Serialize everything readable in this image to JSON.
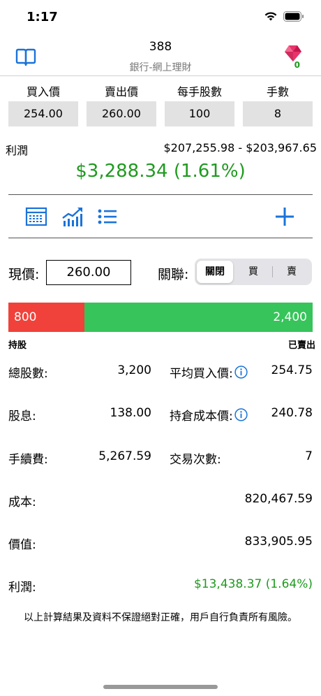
{
  "status": {
    "time": "1:17",
    "wifi_icon": "wifi-icon",
    "battery_icon": "battery-icon"
  },
  "nav": {
    "title": "388",
    "subtitle": "銀行-網上理財",
    "left_icon": "book-icon",
    "right_icon": "gem-icon",
    "gem_count": "0"
  },
  "inputs": [
    {
      "label": "買入價",
      "value": "254.00"
    },
    {
      "label": "賣出價",
      "value": "260.00"
    },
    {
      "label": "每手股數",
      "value": "100"
    },
    {
      "label": "手數",
      "value": "8"
    }
  ],
  "profit": {
    "label": "利潤",
    "range": "$207,255.98 - $203,967.65",
    "main": "$3,288.34 (1.61%)"
  },
  "toolbar": {
    "icons": [
      "table-icon",
      "trend-chart-icon",
      "list-icon",
      "plus-icon"
    ]
  },
  "price": {
    "label": "現價:",
    "value": "260.00",
    "link_label": "關聯:",
    "segments": [
      "關閉",
      "買",
      "賣"
    ],
    "selected_segment": "關閉"
  },
  "holding": {
    "held": "800",
    "sold": "2,400",
    "held_fraction": 0.25,
    "held_label": "持股",
    "sold_label": "已賣出"
  },
  "stats": {
    "total_shares_label": "總股數:",
    "total_shares": "3,200",
    "avg_buy_label": "平均買入價:",
    "avg_buy": "254.75",
    "dividend_label": "股息:",
    "dividend": "138.00",
    "holding_cost_label": "持倉成本價:",
    "holding_cost": "240.78",
    "fee_label": "手續費:",
    "fee": "5,267.59",
    "trades_label": "交易次數:",
    "trades": "7",
    "cost_label": "成本:",
    "cost": "820,467.59",
    "value_label": "價值:",
    "value": "833,905.95",
    "profit_label": "利潤:",
    "profit": "$13,438.37 (1.64%)"
  },
  "disclaimer": "以上計算結果及資料不保證絕對正確，用戶自行負責所有風險。",
  "colors": {
    "accent": "#1a73d9",
    "profit_green": "#1f9a1f",
    "bar_red": "#f0423a",
    "bar_green": "#37c45a"
  }
}
